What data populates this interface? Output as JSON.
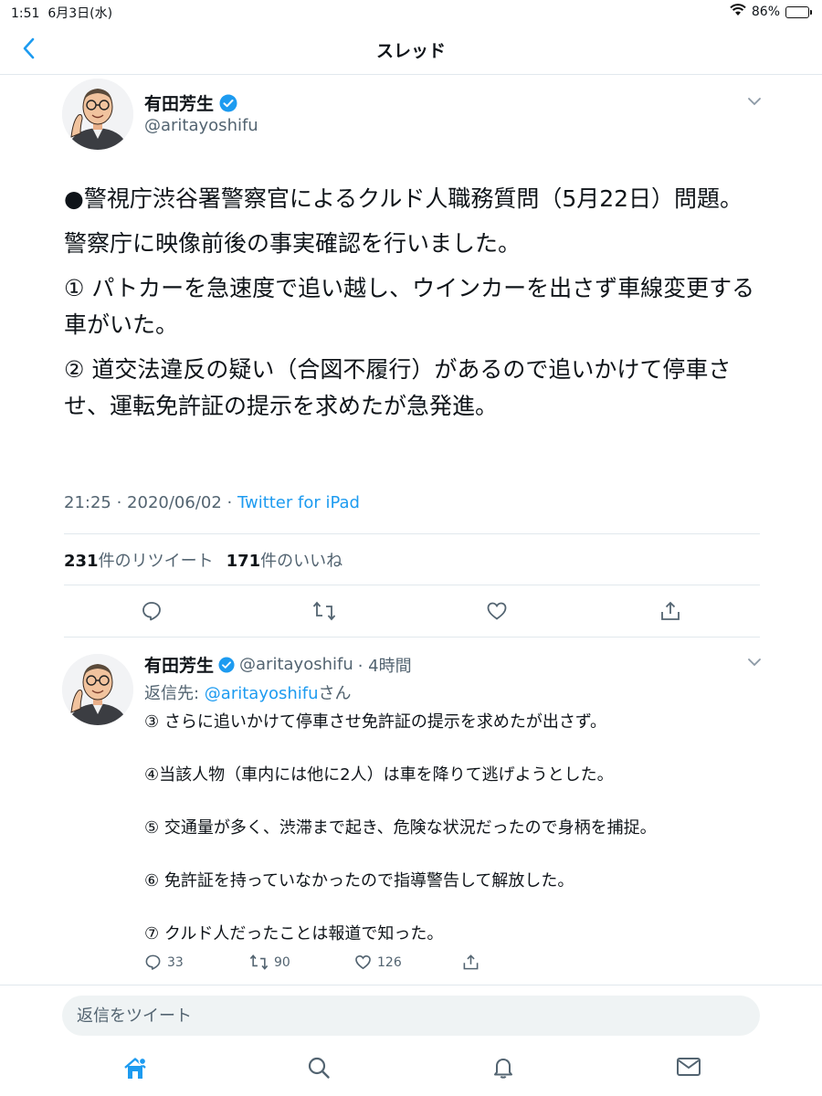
{
  "status_bar": {
    "time": "1:51",
    "date": "6月3日(水)",
    "battery": "86%",
    "battery_level": 0.86
  },
  "nav": {
    "title": "スレッド",
    "back_icon": "chevron-left-icon"
  },
  "main_tweet": {
    "display_name": "有田芳生",
    "handle": "@aritayoshifu",
    "paragraphs": [
      "●警視庁渋谷署警察官によるクルド人職務質問（5月22日）問題。",
      "警察庁に映像前後の事実確認を行いました。",
      "① パトカーを急速度で追い越し、ウインカーを出さず車線変更する車がいた。",
      "② 道交法違反の疑い（合図不履行）があるので追いかけて停車させ、運転免許証の提示を求めたが急発進。"
    ],
    "timestamp": "21:25 · 2020/06/02 · ",
    "source": "Twitter for iPad",
    "retweets_count": "231",
    "retweets_label": "件のリツイート",
    "likes_count": "171",
    "likes_label": "件のいいね"
  },
  "reply_tweet": {
    "display_name": "有田芳生",
    "handle": "@aritayoshifu",
    "time": "· 4時間",
    "reply_prefix": "返信先: ",
    "reply_mention": "@aritayoshifu",
    "reply_suffix": "さん",
    "paragraphs": [
      "③ さらに追いかけて停車させ免許証の提示を求めたが出さず。",
      "④当該人物（車内には他に2人）は車を降りて逃げようとした。",
      "⑤ 交通量が多く、渋滞まで起き、危険な状況だったので身柄を捕捉。",
      "⑥ 免許証を持っていなかったので指導警告して解放した。",
      "⑦  クルド人だったことは報道で知った。"
    ],
    "reply_count": "33",
    "retweet_count": "90",
    "like_count": "126"
  },
  "reply_box": {
    "placeholder": "返信をツイート"
  },
  "tab_bar": [
    "home-icon",
    "search-icon",
    "notifications-icon",
    "messages-icon"
  ],
  "colors": {
    "accent": "#1d9bf0",
    "text": "#0f1419",
    "secondary": "#536471",
    "divider": "#e1e8ed"
  }
}
